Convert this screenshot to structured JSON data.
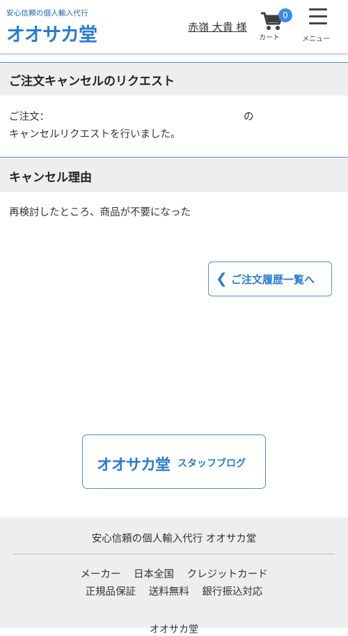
{
  "header": {
    "tagline": "安心信頼の個人輸入代行",
    "logo": "オオサカ堂",
    "user_name": "赤嶺 大貴 様",
    "cart_count": "0",
    "cart_label": "カート",
    "menu_label": "メニュー"
  },
  "request": {
    "heading": "ご注文キャンセルのリクエスト",
    "order_label": "ご注文：",
    "order_suffix": "の",
    "message": "キャンセルリクエストを行いました。"
  },
  "reason": {
    "heading": "キャンセル理由",
    "text": "再検討したところ、商品が不要になった"
  },
  "back_button": {
    "label": "ご注文履歴一覧へ"
  },
  "blog_button": {
    "brand": "オオサカ堂",
    "label": "スタッフブログ"
  },
  "footer": {
    "title": "安心信頼の個人輸入代行 オオサカ堂",
    "row1": [
      "メーカー",
      "日本全国",
      "クレジットカード"
    ],
    "row2": [
      "正規品保証",
      "送料無料",
      "銀行振込対応"
    ],
    "cut_text": "オオサカ堂"
  },
  "colors": {
    "accent": "#2a7bd1",
    "border_blue": "#4a90d9",
    "section_bg": "#eeeeee"
  }
}
